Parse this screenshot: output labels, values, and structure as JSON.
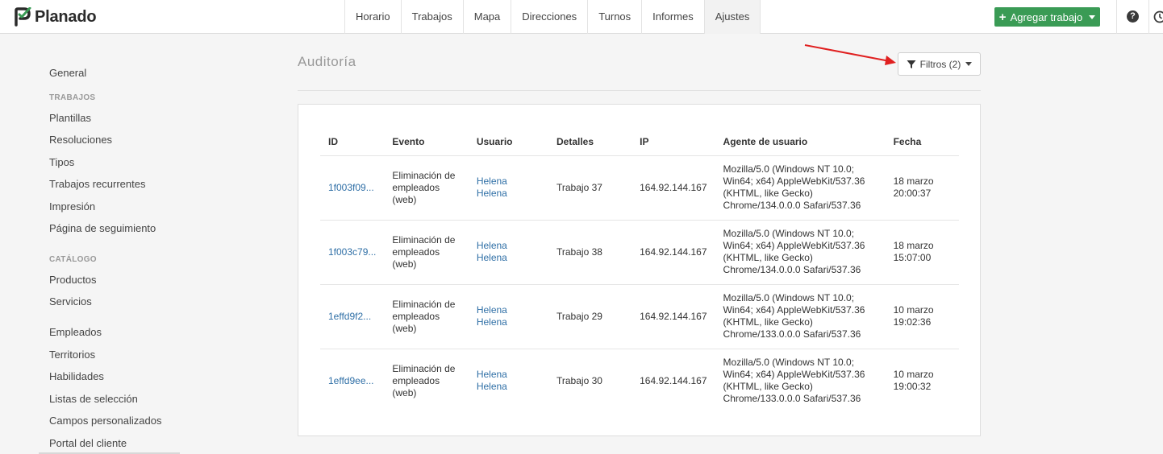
{
  "app": {
    "name": "Planado",
    "brand_color": "#2b2b2b",
    "accent_color": "#3a9b55"
  },
  "nav": {
    "items": [
      {
        "label": "Horario",
        "active": false
      },
      {
        "label": "Trabajos",
        "active": false
      },
      {
        "label": "Mapa",
        "active": false
      },
      {
        "label": "Direcciones",
        "active": false
      },
      {
        "label": "Turnos",
        "active": false
      },
      {
        "label": "Informes",
        "active": false
      },
      {
        "label": "Ajustes",
        "active": true
      }
    ],
    "add_button": {
      "label": "Agregar trabajo",
      "icon": "plus-icon"
    },
    "help_icon": "?",
    "extra_icon": "clock-icon"
  },
  "sidebar": {
    "general": "General",
    "trabajos_head": "TRABAJOS",
    "trabajos": [
      "Plantillas",
      "Resoluciones",
      "Tipos",
      "Trabajos recurrentes",
      "Impresión",
      "Página de seguimiento"
    ],
    "catalogo_head": "CATÁLOGO",
    "catalogo": [
      "Productos",
      "Servicios"
    ],
    "other": [
      "Empleados",
      "Territorios",
      "Habilidades",
      "Listas de selección",
      "Campos personalizados",
      "Portal del cliente"
    ]
  },
  "main": {
    "title": "Auditoría",
    "filter_button": {
      "label": "Filtros (2)",
      "icon": "filter-icon"
    },
    "table": {
      "headers": {
        "id": "ID",
        "event": "Evento",
        "user": "Usuario",
        "details": "Detalles",
        "ip": "IP",
        "agent": "Agente de usuario",
        "date": "Fecha"
      },
      "rows": [
        {
          "id": "1f003f09...",
          "event": [
            "Eliminación de",
            "empleados",
            "(web)"
          ],
          "user": "Helena Helena",
          "details": "Trabajo 37",
          "ip": "164.92.144.167",
          "agent": [
            "Mozilla/5.0 (Windows NT 10.0;",
            "Win64; x64) AppleWebKit/537.36",
            "(KHTML, like Gecko)",
            "Chrome/134.0.0.0 Safari/537.36"
          ],
          "date": [
            "18 marzo",
            "20:00:37"
          ]
        },
        {
          "id": "1f003c79...",
          "event": [
            "Eliminación de",
            "empleados",
            "(web)"
          ],
          "user": "Helena Helena",
          "details": "Trabajo 38",
          "ip": "164.92.144.167",
          "agent": [
            "Mozilla/5.0 (Windows NT 10.0;",
            "Win64; x64) AppleWebKit/537.36",
            "(KHTML, like Gecko)",
            "Chrome/134.0.0.0 Safari/537.36"
          ],
          "date": [
            "18 marzo",
            "15:07:00"
          ]
        },
        {
          "id": "1effd9f2...",
          "event": [
            "Eliminación de",
            "empleados",
            "(web)"
          ],
          "user": "Helena Helena",
          "details": "Trabajo 29",
          "ip": "164.92.144.167",
          "agent": [
            "Mozilla/5.0 (Windows NT 10.0;",
            "Win64; x64) AppleWebKit/537.36",
            "(KHTML, like Gecko)",
            "Chrome/133.0.0.0 Safari/537.36"
          ],
          "date": [
            "10 marzo",
            "19:02:36"
          ]
        },
        {
          "id": "1effd9ee...",
          "event": [
            "Eliminación de",
            "empleados",
            "(web)"
          ],
          "user": "Helena Helena",
          "details": "Trabajo 30",
          "ip": "164.92.144.167",
          "agent": [
            "Mozilla/5.0 (Windows NT 10.0;",
            "Win64; x64) AppleWebKit/537.36",
            "(KHTML, like Gecko)",
            "Chrome/133.0.0.0 Safari/537.36"
          ],
          "date": [
            "10 marzo",
            "19:00:32"
          ]
        }
      ]
    }
  }
}
